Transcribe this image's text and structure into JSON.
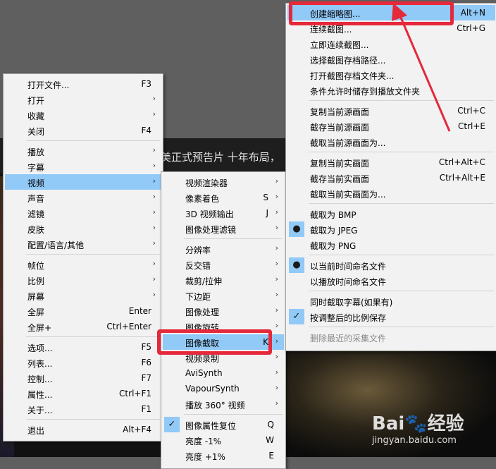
{
  "background": {
    "subtitle": "美正式预告片 十年布局，"
  },
  "main_menu": [
    {
      "label": "打开文件...",
      "shortcut": "F3"
    },
    {
      "label": "打开",
      "submenu": true
    },
    {
      "label": "收藏",
      "submenu": true
    },
    {
      "label": "关闭",
      "shortcut": "F4"
    },
    {
      "sep": true
    },
    {
      "label": "播放",
      "submenu": true
    },
    {
      "label": "字幕",
      "submenu": true
    },
    {
      "label": "视频",
      "submenu": true,
      "highlighted": true
    },
    {
      "label": "声音",
      "submenu": true
    },
    {
      "label": "滤镜",
      "submenu": true
    },
    {
      "label": "皮肤",
      "submenu": true
    },
    {
      "label": "配置/语言/其他",
      "submenu": true
    },
    {
      "sep": true
    },
    {
      "label": "帧位",
      "submenu": true
    },
    {
      "label": "比例",
      "submenu": true
    },
    {
      "label": "屏幕",
      "submenu": true
    },
    {
      "label": "全屏",
      "shortcut": "Enter"
    },
    {
      "label": "全屏+",
      "shortcut": "Ctrl+Enter"
    },
    {
      "sep": true
    },
    {
      "label": "选项...",
      "shortcut": "F5"
    },
    {
      "label": "列表...",
      "shortcut": "F6"
    },
    {
      "label": "控制...",
      "shortcut": "F7"
    },
    {
      "label": "属性...",
      "shortcut": "Ctrl+F1"
    },
    {
      "label": "关于...",
      "shortcut": "F1"
    },
    {
      "sep": true
    },
    {
      "label": "退出",
      "shortcut": "Alt+F4"
    }
  ],
  "video_menu": [
    {
      "label": "视频渲染器",
      "submenu": true
    },
    {
      "label": "像素着色",
      "shortcut": "S",
      "submenu": true
    },
    {
      "label": "3D 视频输出",
      "shortcut": "J",
      "submenu": true
    },
    {
      "label": "图像处理滤镜",
      "submenu": true
    },
    {
      "sep": true
    },
    {
      "label": "分辨率",
      "submenu": true
    },
    {
      "label": "反交错",
      "submenu": true
    },
    {
      "label": "裁剪/拉伸",
      "submenu": true
    },
    {
      "label": "下边距",
      "submenu": true
    },
    {
      "label": "图像处理",
      "submenu": true
    },
    {
      "label": "图像旋转",
      "submenu": true
    },
    {
      "label": "图像截取",
      "shortcut": "K",
      "submenu": true,
      "highlighted": true
    },
    {
      "label": "视频录制",
      "submenu": true
    },
    {
      "label": "AviSynth",
      "submenu": true
    },
    {
      "label": "VapourSynth",
      "submenu": true
    },
    {
      "label": "播放 360° 视频",
      "submenu": true
    },
    {
      "sep": true
    },
    {
      "label": "图像属性复位",
      "shortcut": "Q",
      "mark": "✓"
    },
    {
      "label": "亮度 -1%",
      "shortcut": "W"
    },
    {
      "label": "亮度 +1%",
      "shortcut": "E"
    }
  ],
  "capture_menu": [
    {
      "label": "创建缩略图...",
      "shortcut": "Alt+N",
      "highlighted": true
    },
    {
      "label": "连续截图...",
      "shortcut": "Ctrl+G"
    },
    {
      "label": "立即连续截图..."
    },
    {
      "label": "选择截图存档路径..."
    },
    {
      "label": "打开截图存档文件夹..."
    },
    {
      "label": "条件允许时储存到播放文件夹"
    },
    {
      "sep": true
    },
    {
      "label": "复制当前源画面",
      "shortcut": "Ctrl+C"
    },
    {
      "label": "截存当前源画面",
      "shortcut": "Ctrl+E"
    },
    {
      "label": "截取当前源画面为..."
    },
    {
      "sep": true
    },
    {
      "label": "复制当前实画面",
      "shortcut": "Ctrl+Alt+C"
    },
    {
      "label": "截存当前实画面",
      "shortcut": "Ctrl+Alt+E"
    },
    {
      "label": "截取当前实画面为..."
    },
    {
      "sep": true
    },
    {
      "label": "截取为 BMP"
    },
    {
      "label": "截取为 JPEG",
      "mark": "●"
    },
    {
      "label": "截取为 PNG"
    },
    {
      "sep": true
    },
    {
      "label": "以当前时间命名文件",
      "mark": "●"
    },
    {
      "label": "以播放时间命名文件"
    },
    {
      "sep": true
    },
    {
      "label": "同时截取字幕(如果有)"
    },
    {
      "label": "按调整后的比例保存",
      "mark": "✓"
    },
    {
      "sep": true
    },
    {
      "label": "删除最近的采集文件",
      "disabled": true
    }
  ],
  "watermark": {
    "logo": "Bai🐾经验",
    "url": "jingyan.baidu.com"
  }
}
